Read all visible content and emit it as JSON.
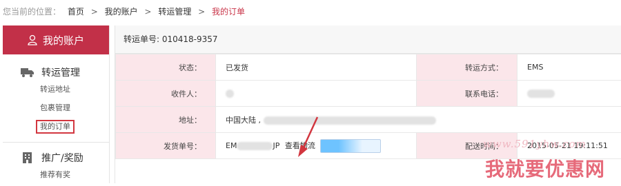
{
  "breadcrumb": {
    "prefix": "您当前的位置：",
    "items": [
      "首页",
      "我的账户",
      "转运管理",
      "我的订单"
    ],
    "separator": ">"
  },
  "sidebar": {
    "header": "我的账户",
    "groups": [
      {
        "title": "转运管理",
        "icon": "truck-icon",
        "items": [
          "转运地址",
          "包裹管理",
          "我的订单"
        ],
        "active_index": 2
      },
      {
        "title": "推广/奖励",
        "icon": "building-icon",
        "items": [
          "推荐有奖"
        ]
      }
    ]
  },
  "order": {
    "transfer_label": "转运单号:",
    "transfer_no": "010418-9357",
    "status_label": "状态：",
    "status": "已发货",
    "method_label": "转运方式：",
    "method": "EMS",
    "recipient_label": "收件人：",
    "phone_label": "联系电话：",
    "address_label": "地址：",
    "address_prefix": "中国大陆 ,",
    "ship_no_label": "发货单号：",
    "ship_no_start": "EM",
    "ship_no_end": "JP",
    "track_link": "查看物流",
    "delivery_time_label": "配送时间：",
    "delivery_time": "2015-05-21 19:11:51"
  },
  "watermark": {
    "url": "www.591yhw.com",
    "text": "我就要优惠网"
  },
  "colors": {
    "accent": "#c23048",
    "label_bg": "#fbe6ea"
  }
}
